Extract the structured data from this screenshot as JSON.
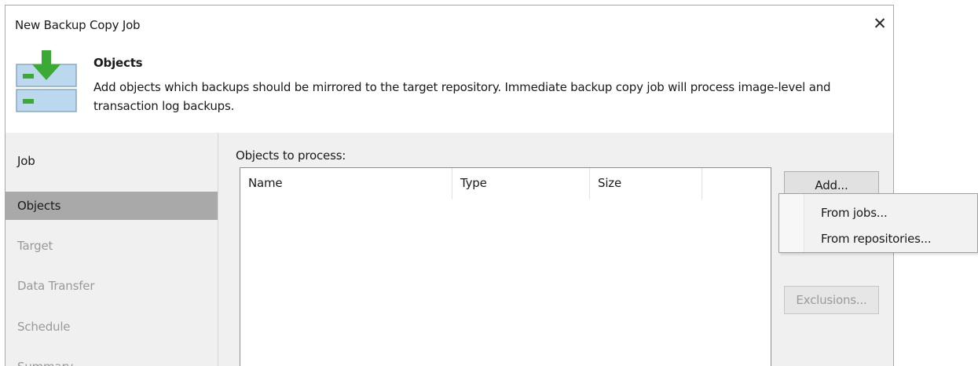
{
  "window": {
    "title": "New Backup Copy Job",
    "close_symbol": "✕"
  },
  "header": {
    "icon": "backup-copy-icon",
    "section_title": "Objects",
    "description": "Add objects which backups should be mirrored to the target repository. Immediate backup copy job will process image-level and transaction log backups."
  },
  "sidebar": {
    "items": [
      {
        "label": "Job",
        "state": "done"
      },
      {
        "label": "Objects",
        "state": "active"
      },
      {
        "label": "Target",
        "state": "pending"
      },
      {
        "label": "Data Transfer",
        "state": "pending"
      },
      {
        "label": "Schedule",
        "state": "pending"
      },
      {
        "label": "Summary",
        "state": "pending"
      }
    ]
  },
  "content": {
    "objects_label": "Objects to process:",
    "columns": [
      "Name",
      "Type",
      "Size"
    ],
    "rows": []
  },
  "buttons": {
    "add_label": "Add...",
    "exclusions_label": "Exclusions..."
  },
  "add_menu": {
    "items": [
      "From jobs...",
      "From repositories..."
    ]
  },
  "colors": {
    "accent_green": "#3aaa35",
    "selected_sidebar": "#a9a9a9",
    "icon_blue": "#bcd8ee"
  }
}
